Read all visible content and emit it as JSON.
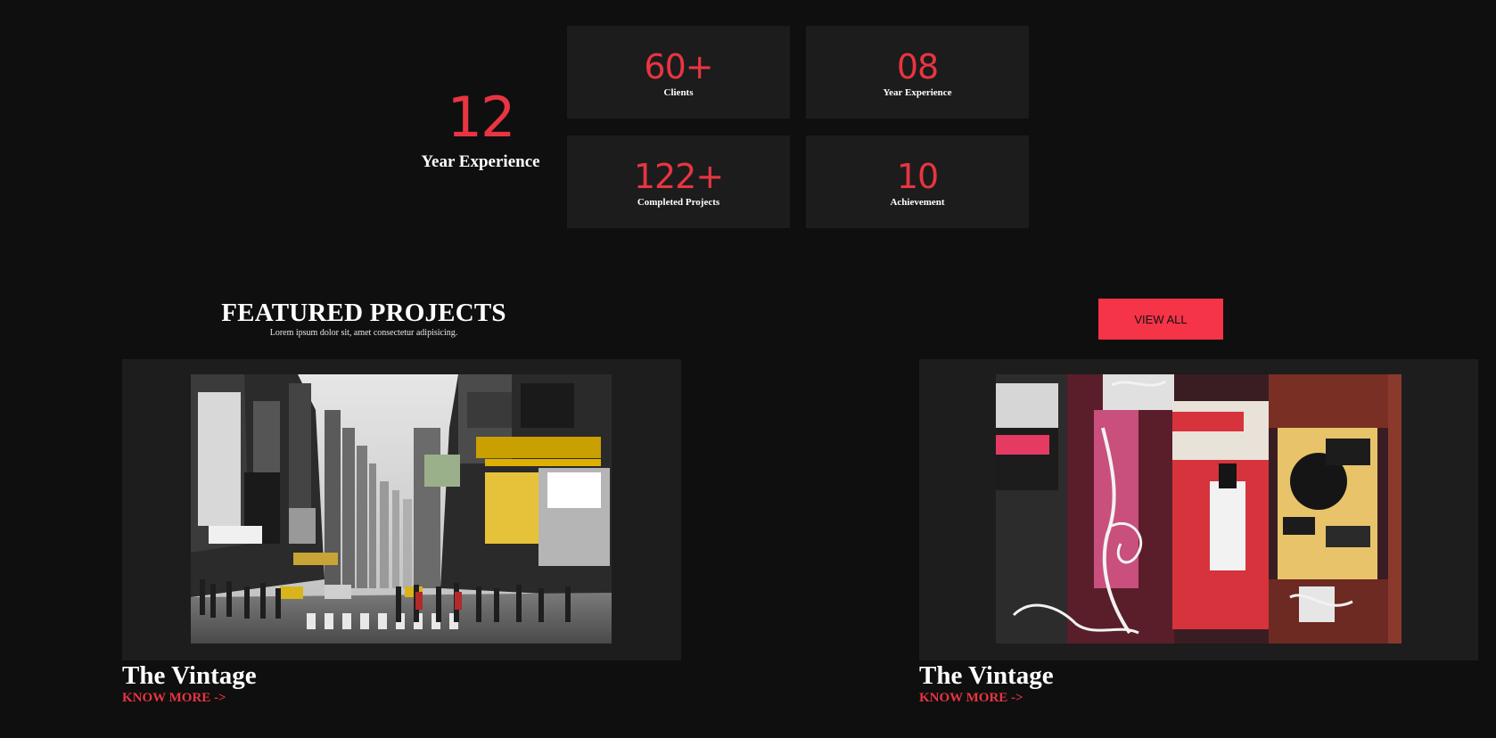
{
  "experience": {
    "number": "12",
    "label": "Year Experience"
  },
  "stats": [
    {
      "value": "60+",
      "label": "Clients"
    },
    {
      "value": "08",
      "label": "Year Experience"
    },
    {
      "value": "122+",
      "label": "Completed Projects"
    },
    {
      "value": "10",
      "label": "Achievement"
    }
  ],
  "featured": {
    "title": "FEATURED PROJECTS",
    "subtitle": "Lorem ipsum dolor sit, amet consectetur adipisicing.",
    "view_all_label": "VIEW ALL"
  },
  "projects": [
    {
      "title": "The Vintage",
      "link_label": "KNOW MORE ->",
      "image": "city-street-photo"
    },
    {
      "title": "The Vintage",
      "link_label": "KNOW MORE ->",
      "image": "poster-wall-photo"
    }
  ],
  "colors": {
    "background": "#0f0f0f",
    "card": "#1c1c1c",
    "accent": "#e83541",
    "button": "#f53447"
  }
}
